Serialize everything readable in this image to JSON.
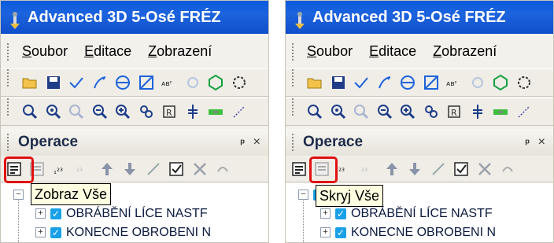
{
  "panels": [
    {
      "id": "left",
      "title": "Advanced 3D 5-Osé FRÉZ",
      "menu": [
        {
          "accel": "S",
          "rest": "oubor"
        },
        {
          "accel": "E",
          "rest": "ditace"
        },
        {
          "accel": "Z",
          "rest": "obrazení"
        }
      ],
      "dock_title": "Operace",
      "dock_pin": "ᵖ",
      "dock_close": "×",
      "tooltip": "Zobraz Vše",
      "tree_items": [
        "OBRÁBĚNÍ LÍCE  NASTF",
        "KONECNE OBROBENI  N"
      ]
    },
    {
      "id": "right",
      "title": "Advanced 3D 5-Osé FRÉZ",
      "menu": [
        {
          "accel": "S",
          "rest": "oubor"
        },
        {
          "accel": "E",
          "rest": "ditace"
        },
        {
          "accel": "Z",
          "rest": "obrazení"
        }
      ],
      "dock_title": "Operace",
      "dock_pin": "ᵖ",
      "dock_close": "×",
      "tooltip": "Skryj Vše",
      "tree_items": [
        "OBRÁBĚNÍ LÍCE  NASTF",
        "KONECNE OBROBENI  N"
      ]
    }
  ],
  "colors": {
    "title_bar": "#1d63dd",
    "highlight": "#e01010",
    "tooltip_bg": "#ffffe1",
    "check": "#1aa0e8"
  },
  "icons": {
    "toolbar1": [
      "open-folder-icon",
      "save-icon",
      "check-path-icon",
      "arrow-curve-icon",
      "circle-minus-icon",
      "zoom-rect-icon",
      "abc-text-icon",
      "flower-icon",
      "hexagon-icon",
      "gear-icon"
    ],
    "toolbar2": [
      "zoom-window-icon",
      "zoom-in-icon",
      "zoom-prev-icon",
      "zoom-fit-icon",
      "zoom-plus-icon",
      "pan-icon",
      "r-frame-icon",
      "axis-icon",
      "green-bar-icon",
      "diagonal-arrow-icon"
    ],
    "ops_toolbar": [
      "list-show-icon",
      "list-hide-icon",
      "numbering-icon",
      "renumber-icon",
      "move-up-icon",
      "move-down-icon",
      "wand-icon",
      "checklist-icon",
      "delete-icon",
      "undo-icon"
    ]
  }
}
